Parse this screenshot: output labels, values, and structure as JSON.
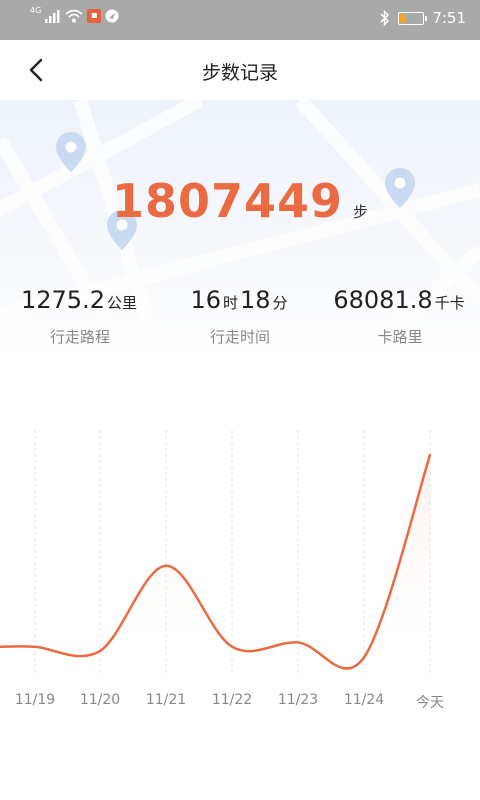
{
  "status_bar": {
    "network": "4G",
    "time": "7:51",
    "battery_level": 0.25,
    "icons": [
      "signal-icon",
      "wifi-icon",
      "notification-icon",
      "location-icon",
      "bluetooth-icon",
      "battery-icon"
    ]
  },
  "header": {
    "title": "步数记录",
    "back_icon": "chevron-left-icon"
  },
  "summary": {
    "total_steps": "1807449",
    "steps_unit": "步"
  },
  "stats": [
    {
      "value": "1275.2",
      "unit": "公里",
      "label": "行走路程"
    },
    {
      "hours": "16",
      "hours_unit": "时",
      "minutes": "18",
      "minutes_unit": "分",
      "label": "行走时间"
    },
    {
      "value": "68081.8",
      "unit": "千卡",
      "label": "卡路里"
    }
  ],
  "colors": {
    "accent": "#ea6a42",
    "status_bar": "#a9a9a9",
    "hero_bg": "#eef3fb",
    "map_pin": "#c9daf3",
    "label_gray": "#888888"
  },
  "chart_data": {
    "type": "area",
    "categories": [
      "11/19",
      "11/20",
      "11/21",
      "11/22",
      "11/23",
      "11/24",
      "今天"
    ],
    "values": [
      0.1,
      0.08,
      0.48,
      0.1,
      0.12,
      0.05,
      1.0
    ],
    "value_scale": "relative (no y axis shown)",
    "curve": "smooth",
    "grid": "vertical dashed lines at each date",
    "ylim": [
      0,
      1.0
    ],
    "color": "#ea6a42"
  }
}
